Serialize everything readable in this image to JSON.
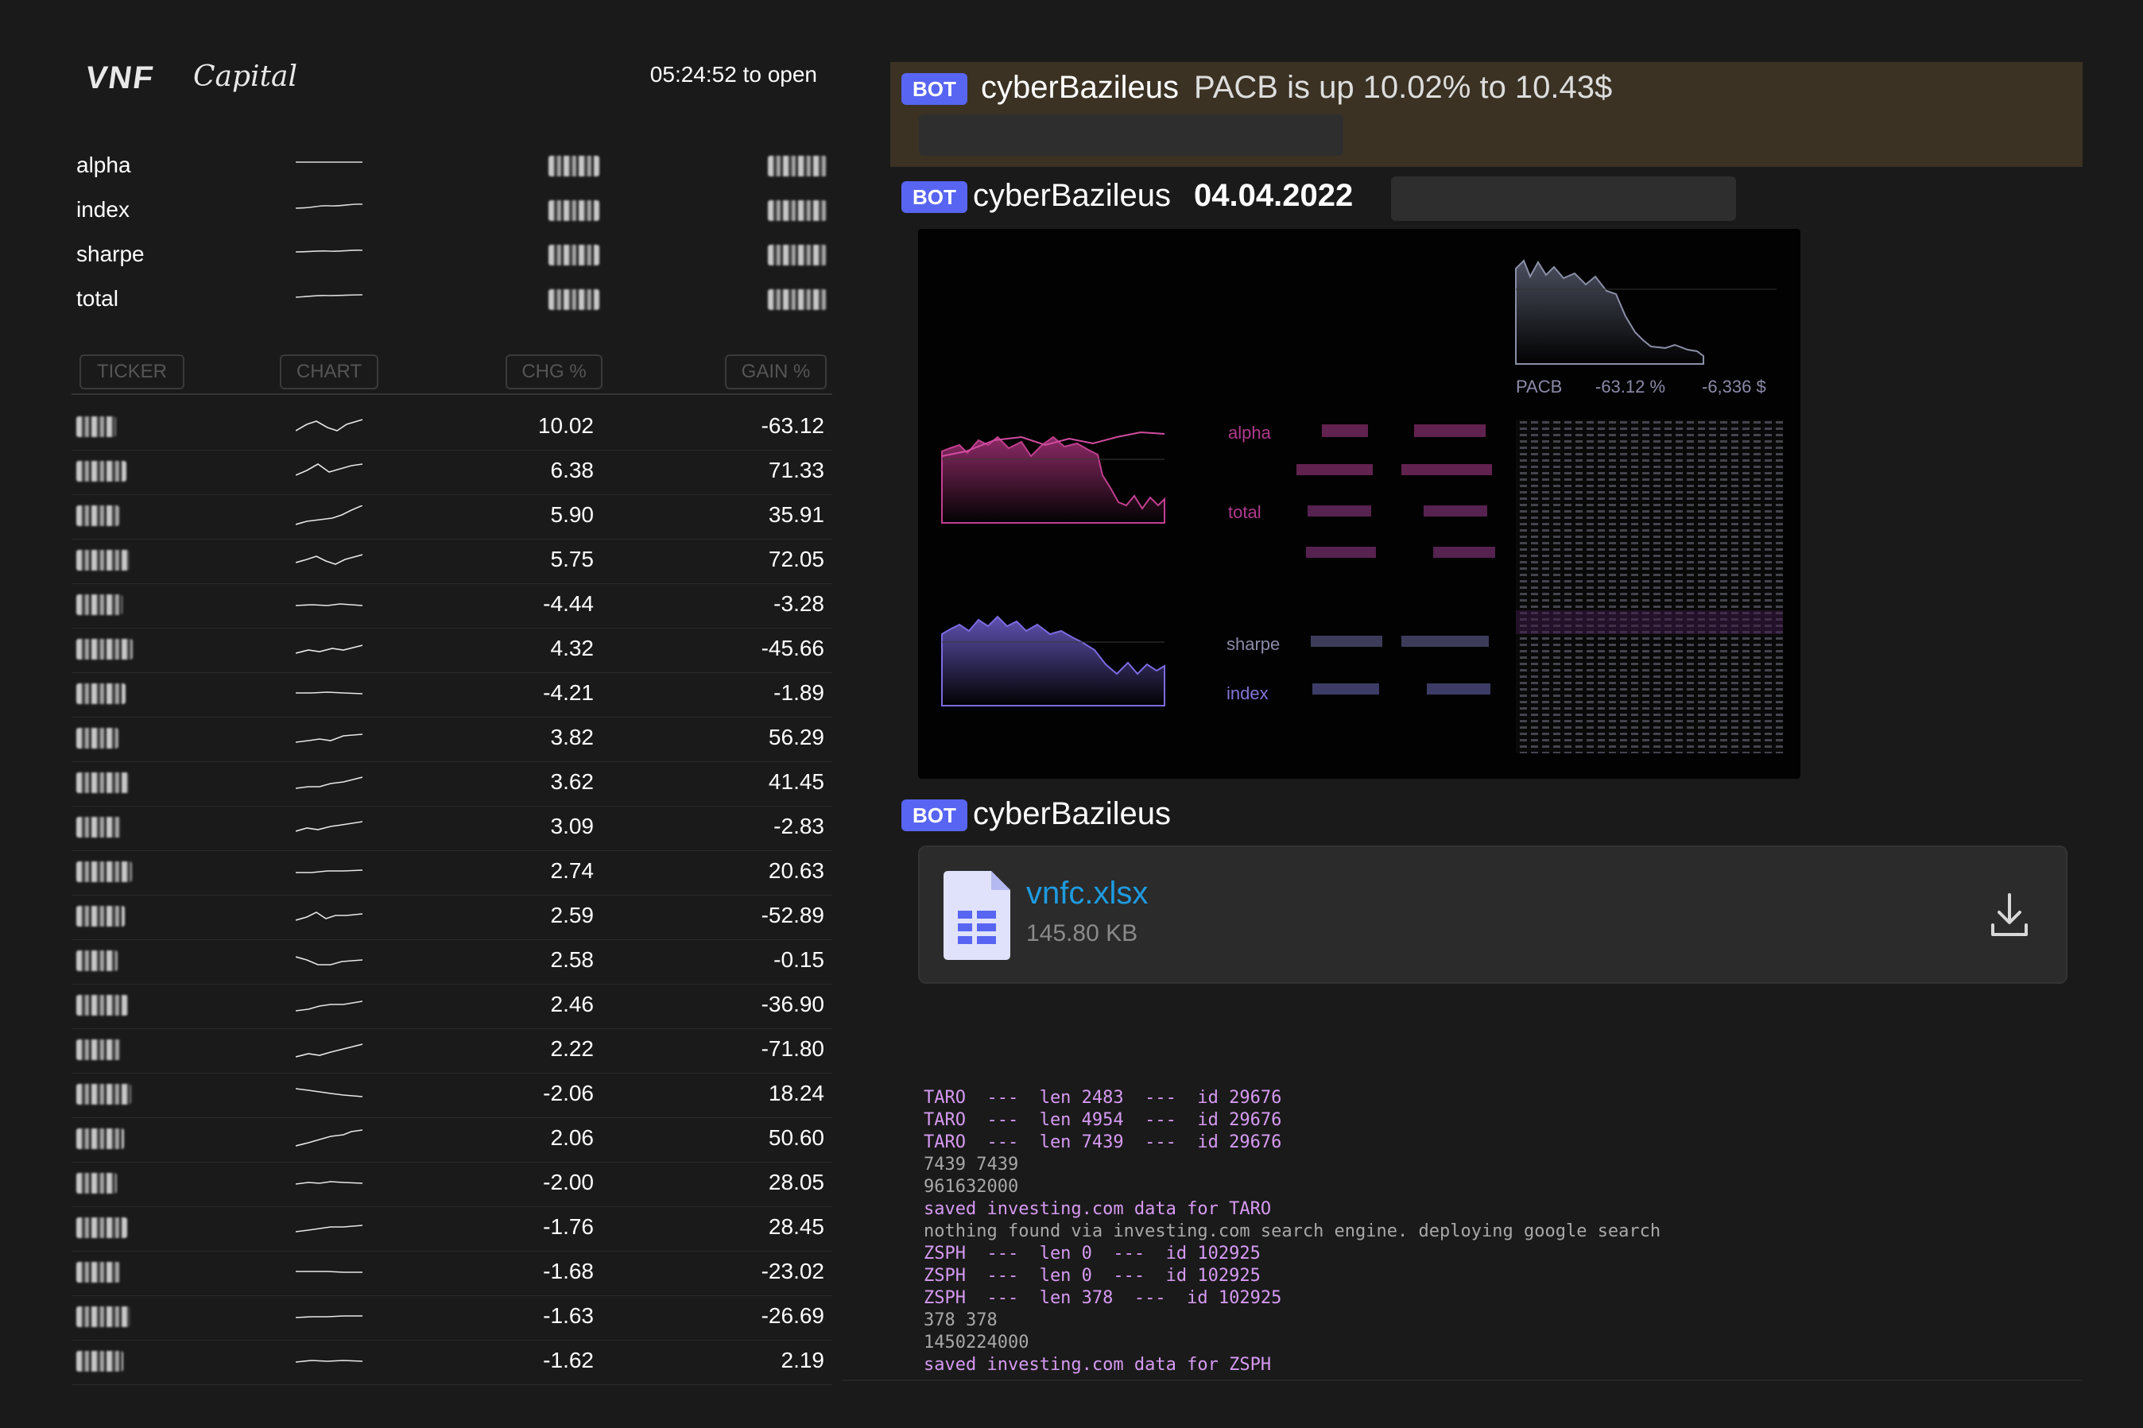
{
  "header": {
    "logo_main": "VNF",
    "logo_script": "Capital",
    "clock": "05:24:52 to open"
  },
  "stats": [
    {
      "label": "alpha"
    },
    {
      "label": "index"
    },
    {
      "label": "sharpe"
    },
    {
      "label": "total"
    }
  ],
  "table": {
    "headers": [
      "TICKER",
      "CHART",
      "CHG %",
      "GAIN %"
    ],
    "rows": [
      {
        "chg": "10.02",
        "gain": "-63.12"
      },
      {
        "chg": "6.38",
        "gain": "71.33"
      },
      {
        "chg": "5.90",
        "gain": "35.91"
      },
      {
        "chg": "5.75",
        "gain": "72.05"
      },
      {
        "chg": "-4.44",
        "gain": "-3.28"
      },
      {
        "chg": "4.32",
        "gain": "-45.66"
      },
      {
        "chg": "-4.21",
        "gain": "-1.89"
      },
      {
        "chg": "3.82",
        "gain": "56.29"
      },
      {
        "chg": "3.62",
        "gain": "41.45"
      },
      {
        "chg": "3.09",
        "gain": "-2.83"
      },
      {
        "chg": "2.74",
        "gain": "20.63"
      },
      {
        "chg": "2.59",
        "gain": "-52.89"
      },
      {
        "chg": "2.58",
        "gain": "-0.15"
      },
      {
        "chg": "2.46",
        "gain": "-36.90"
      },
      {
        "chg": "2.22",
        "gain": "-71.80"
      },
      {
        "chg": "-2.06",
        "gain": "18.24"
      },
      {
        "chg": "2.06",
        "gain": "50.60"
      },
      {
        "chg": "-2.00",
        "gain": "28.05"
      },
      {
        "chg": "-1.76",
        "gain": "28.45"
      },
      {
        "chg": "-1.68",
        "gain": "-23.02"
      },
      {
        "chg": "-1.63",
        "gain": "-26.69"
      },
      {
        "chg": "-1.62",
        "gain": "2.19"
      }
    ]
  },
  "messages": {
    "badge": "BOT",
    "user": "cyberBazileus",
    "msg1_text": "PACB is up 10.02% to 10.43$",
    "msg2_date": "04.04.2022",
    "chart_labels": {
      "ticker": "PACB",
      "pct": "-63.12 %",
      "usd": "-6,336 $",
      "alpha": "alpha",
      "total": "total",
      "sharpe": "sharpe",
      "index": "index"
    },
    "file": {
      "name": "vnfc.xlsx",
      "size": "145.80 KB"
    }
  },
  "console": [
    {
      "text": "TARO  ---  len 2483  ---  id 29676",
      "tone": "purple"
    },
    {
      "text": "TARO  ---  len 4954  ---  id 29676",
      "tone": "purple"
    },
    {
      "text": "TARO  ---  len 7439  ---  id 29676",
      "tone": "purple"
    },
    {
      "text": "7439 7439",
      "tone": "gray"
    },
    {
      "text": "961632000",
      "tone": "gray"
    },
    {
      "text": "saved investing.com data for TARO",
      "tone": "purple"
    },
    {
      "text": "nothing found via investing.com search engine. deploying google search",
      "tone": "gray"
    },
    {
      "text": "ZSPH  ---  len 0  ---  id 102925",
      "tone": "purple"
    },
    {
      "text": "ZSPH  ---  len 0  ---  id 102925",
      "tone": "purple"
    },
    {
      "text": "ZSPH  ---  len 378  ---  id 102925",
      "tone": "purple"
    },
    {
      "text": "378 378",
      "tone": "gray"
    },
    {
      "text": "1450224000",
      "tone": "gray"
    },
    {
      "text": "saved investing.com data for ZSPH",
      "tone": "purple"
    }
  ],
  "colors": {
    "bot_badge": "#5865f2",
    "highlight_bg": "#3b3224",
    "file_link": "#1e9be0",
    "console_purple": "#d69af2"
  },
  "icons": {
    "file": "spreadsheet-file-icon",
    "download": "download-icon"
  }
}
